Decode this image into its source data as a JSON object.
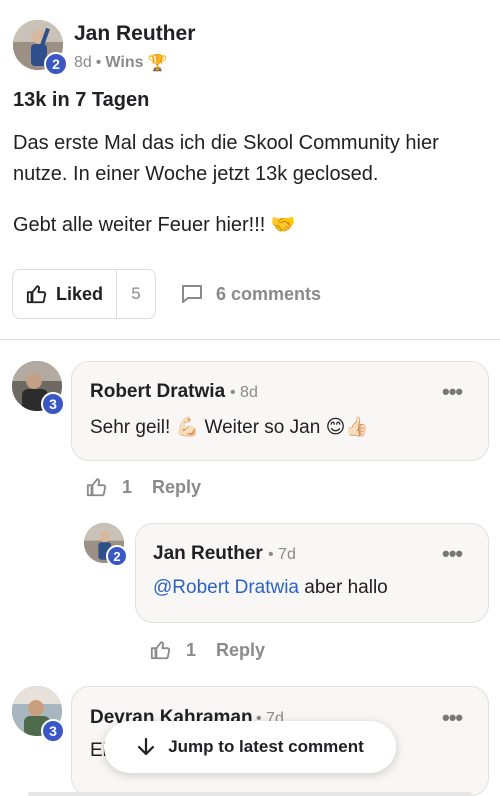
{
  "post": {
    "author": "Jan Reuther",
    "level": "2",
    "time": "8d",
    "separator": "•",
    "category": "Wins",
    "category_emoji": "🏆",
    "title": "13k in 7 Tagen",
    "body_line1": "Das erste Mal das ich die Skool Community hier nutze. In einer Woche jetzt 13k geclosed.",
    "body_line2": "Gebt alle weiter Feuer hier!!! 🤝",
    "like_label": "Liked",
    "like_count": "5",
    "comments_label": "6 comments"
  },
  "comments": [
    {
      "author": "Robert Dratwia",
      "level": "3",
      "time": "• 8d",
      "text": "Sehr geil! 💪🏻 Weiter so Jan 😊👍🏻",
      "likes": "1",
      "reply_label": "Reply"
    },
    {
      "author": "Jan Reuther",
      "level": "2",
      "time": "• 7d",
      "mention": "@Robert Dratwia",
      "text": " aber hallo",
      "likes": "1",
      "reply_label": "Reply"
    },
    {
      "author": "Devran Kahraman",
      "level": "3",
      "time": "• 7d",
      "text": "Ei"
    }
  ],
  "more_icon": "•••",
  "jump_label": "Jump to latest comment",
  "colors": {
    "accent": "#3b57c4",
    "mention": "#2b62c9",
    "muted": "#8a8a8a"
  }
}
